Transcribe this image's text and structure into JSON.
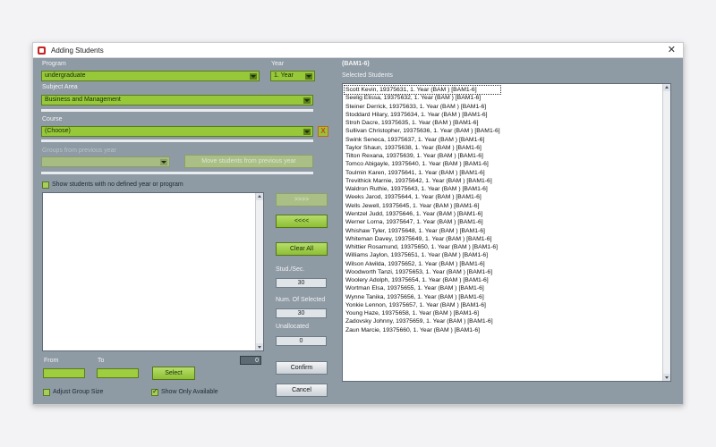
{
  "window": {
    "title": "Adding Students"
  },
  "left": {
    "program_label": "Program",
    "program_value": "undergraduate",
    "year_label": "Year",
    "year_value": "1. Year",
    "subject_label": "Subject Area",
    "subject_value": "Business and Management",
    "course_label": "Course",
    "course_value": "(Choose)",
    "clear_course": "X",
    "groups_label": "Groups from previous year",
    "move_button": "Move students from previous year",
    "show_undefined_label": "Show students with no defined year or program",
    "from_label": "From",
    "to_label": "To",
    "select_button": "Select",
    "count_value": "0",
    "adjust_label": "Adjust Group Size",
    "show_available_label": "Show Only Available"
  },
  "middle": {
    "add_button": ">>>>",
    "remove_button": "<<<<",
    "clear_all_button": "Clear All",
    "stud_sec_label": "Stud./Sec.",
    "stud_sec_value": "30",
    "num_selected_label": "Num. Of Selected",
    "num_selected_value": "30",
    "unallocated_label": "Unallocated",
    "unallocated_value": "0",
    "confirm_button": "Confirm",
    "cancel_button": "Cancel"
  },
  "right": {
    "group_code": "(BAM1-6)",
    "selected_label": "Selected Students",
    "students": [
      "Scott Kevin, 19375631, 1. Year (BAM ) [BAM1-6]",
      "Seelig Elissa, 19375632, 1. Year (BAM ) [BAM1-6]",
      "Steiner Derrick, 19375633, 1. Year (BAM ) [BAM1-6]",
      "Stoddard Hilary, 19375634, 1. Year (BAM ) [BAM1-6]",
      "Stroh Dacre, 19375635, 1. Year (BAM ) [BAM1-6]",
      "Sullivan Christopher, 19375636, 1. Year (BAM ) [BAM1-6]",
      "Swink Seneca, 19375637, 1. Year (BAM ) [BAM1-6]",
      "Taylor Shaun, 19375638, 1. Year (BAM ) [BAM1-6]",
      "Tilton Rexana, 19375639, 1. Year (BAM ) [BAM1-6]",
      "Tomco Abigayle, 19375640, 1. Year (BAM ) [BAM1-6]",
      "Toulmin Karen, 19375641, 1. Year (BAM ) [BAM1-6]",
      "Trevithick Marnie, 19375642, 1. Year (BAM ) [BAM1-6]",
      "Waldron Ruthie, 19375643, 1. Year (BAM ) [BAM1-6]",
      "Weeks Jarod, 19375644, 1. Year (BAM ) [BAM1-6]",
      "Wells Jewell, 19375645, 1. Year (BAM ) [BAM1-6]",
      "Wentzel Judd, 19375646, 1. Year (BAM ) [BAM1-6]",
      "Werner Lorna, 19375647, 1. Year (BAM ) [BAM1-6]",
      "Whishaw Tyler, 19375648, 1. Year (BAM ) [BAM1-6]",
      "Whiteman Davey, 19375649, 1. Year (BAM ) [BAM1-6]",
      "Whittier Rosamund, 19375650, 1. Year (BAM ) [BAM1-6]",
      "Williams Jaylon, 19375651, 1. Year (BAM ) [BAM1-6]",
      "Wilson Alwilda, 19375652, 1. Year (BAM ) [BAM1-6]",
      "Woodworth Tanzi, 19375653, 1. Year (BAM ) [BAM1-6]",
      "Woolery Adolph, 19375654, 1. Year (BAM ) [BAM1-6]",
      "Wortman Elsa, 19375655, 1. Year (BAM ) [BAM1-6]",
      "Wynne Tanika, 19375656, 1. Year (BAM ) [BAM1-6]",
      "Yonkie Lennon, 19375657, 1. Year (BAM ) [BAM1-6]",
      "Young Haze, 19375658, 1. Year (BAM ) [BAM1-6]",
      "Zadovsky Johnny, 19375659, 1. Year (BAM ) [BAM1-6]",
      "Zaun Marcie, 19375660, 1. Year (BAM ) [BAM1-6]"
    ]
  },
  "colors": {
    "accent_green": "#96c83a",
    "window_bg": "#8e9aa4",
    "close_red": "#d43e10"
  }
}
